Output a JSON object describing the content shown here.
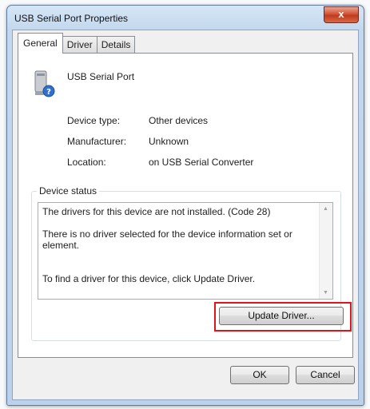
{
  "window": {
    "title": "USB Serial Port Properties",
    "close_label": "x"
  },
  "tabs": [
    {
      "label": "General",
      "active": true
    },
    {
      "label": "Driver",
      "active": false
    },
    {
      "label": "Details",
      "active": false
    }
  ],
  "device": {
    "icon": "usb-serial-port-icon",
    "name": "USB Serial Port",
    "properties": [
      {
        "label": "Device type:",
        "value": "Other devices"
      },
      {
        "label": "Manufacturer:",
        "value": "Unknown"
      },
      {
        "label": "Location:",
        "value": "on USB Serial Converter"
      }
    ]
  },
  "status": {
    "legend": "Device status",
    "text": "The drivers for this device are not installed. (Code 28)\n\nThere is no driver selected for the device information set or element.\n\n\nTo find a driver for this device, click Update Driver."
  },
  "buttons": {
    "update_driver": "Update Driver...",
    "ok": "OK",
    "cancel": "Cancel"
  },
  "colors": {
    "highlight": "#e0141a",
    "title_bar": "#c3d8ee",
    "close_button": "#c13a1e"
  }
}
